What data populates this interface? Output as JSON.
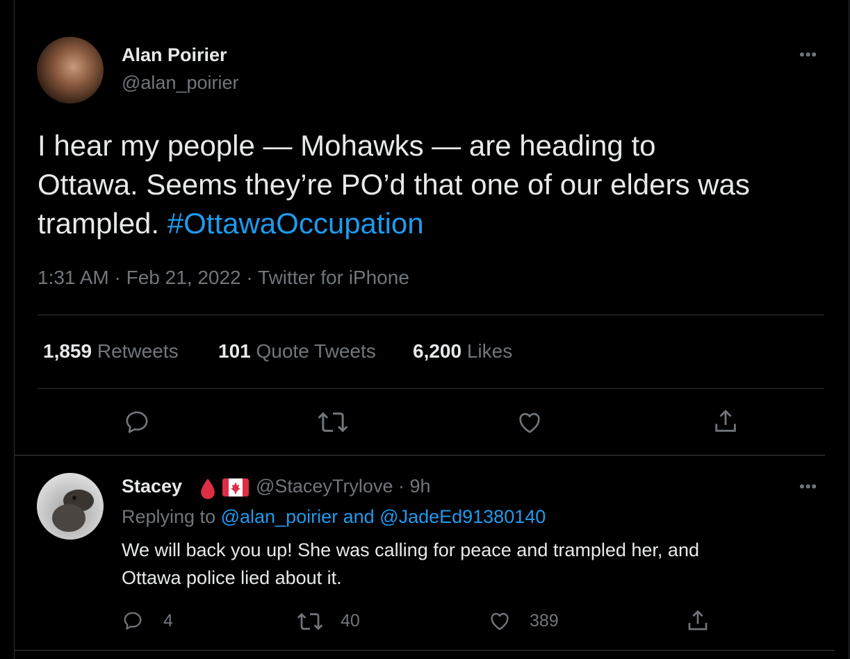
{
  "tweet": {
    "author_name": "Alan Poirier",
    "author_handle": "@alan_poirier",
    "more_label": "•••",
    "text_line1": "I hear my people — Mohawks — are heading to",
    "text_line2": "Ottawa. Seems they’re PO’d that one of our elders was",
    "text_line3_plain": "trampled. ",
    "hashtag": "#OttawaOccupation",
    "meta": "1:31 AM · Feb 21, 2022 · Twitter for iPhone",
    "stats": {
      "retweets_count": "1,859",
      "retweets_label": "Retweets",
      "quotes_count": "101",
      "quotes_label": "Quote Tweets",
      "likes_count": "6,200",
      "likes_label": "Likes"
    }
  },
  "reply": {
    "author_name": "Stacey",
    "author_handle": "@StaceyTrylove · 9h",
    "more_label": "•••",
    "replying_prefix": "Replying to ",
    "mention1": "@alan_poirier",
    "and_word": " and ",
    "mention2": "@JadeEd91380140",
    "text_line1": "We will back you up! She was calling for peace and trampled her, and",
    "text_line2": "Ottawa police lied about it.",
    "reply_count": "4",
    "retweet_count": "40",
    "like_count": "389"
  },
  "icons": {
    "reply": "reply-bubble-icon",
    "retweet": "retweet-arrows-icon",
    "like": "heart-icon",
    "share": "share-upload-icon",
    "blood_drop": "red-drop-emoji",
    "flag": "canada-flag-emoji"
  },
  "colors": {
    "background": "#000000",
    "text": "#e7e9ea",
    "secondary": "#71767b",
    "link": "#1d9bf0",
    "divider": "#2f3336"
  }
}
